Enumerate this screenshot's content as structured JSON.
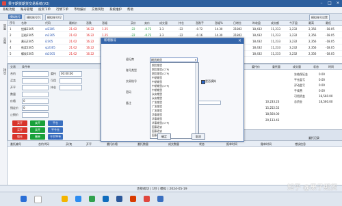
{
  "app": {
    "title": "果子期货期货交易系统(V2)"
  },
  "menu": [
    "系统功能",
    "账号管理",
    "投资下单",
    "行情下单",
    "市场报价",
    "交易风险",
    "系统维护",
    "帮助"
  ],
  "accounts": {
    "tabs": [
      "模拟账号",
      "模拟账号01",
      "模拟账号02"
    ],
    "right_tab": "模拟账号设置"
  },
  "left_strip": [
    "资金",
    "交易",
    "持仓"
  ],
  "positions": {
    "headers": [
      "序号",
      "名称",
      "代码",
      "最新价",
      "涨跌",
      "涨幅",
      "买价",
      "卖价",
      "成交量",
      "持仓",
      "涨跌手",
      "涨幅%",
      "日增仓",
      "昨收盘",
      "成交额",
      "今开盘",
      "最高",
      "最低"
    ],
    "rows": [
      [
        "1",
        "铝棒2305",
        "al2305",
        "21.02",
        "16.22",
        "1.25",
        "-22",
        "-0.72",
        "3.3",
        "-22",
        "-0.72",
        "14.30",
        "21802",
        "18,432",
        "11,233",
        "3,232",
        "2,356",
        "-18.05"
      ],
      [
        "2",
        "豆粕2305",
        "m2305",
        "21.02",
        "16.22",
        "1.25",
        "-22",
        "-0.72",
        "3.3",
        "-22",
        "-0.16",
        "14.30",
        "21802",
        "18,432",
        "11,233",
        "3,232",
        "2,356",
        "-18.05"
      ],
      [
        "3",
        "黄石2305",
        "i2305",
        "21.02",
        "16.22",
        "1.25",
        "-22",
        "-0.72",
        "3.3",
        "-22",
        "-0.72",
        "14.30",
        "21802",
        "18,432",
        "11,233",
        "3,232",
        "2,356",
        "-18.05"
      ],
      [
        "4",
        "纸浆2305",
        "sp2305",
        "21.02",
        "16.22",
        "1.25",
        "-22",
        "-0.72",
        "3.3",
        "-22",
        "-0.16",
        "14.30",
        "21802",
        "18,432",
        "11,233",
        "3,232",
        "2,356",
        "-18.05"
      ],
      [
        "5",
        "螺纹2305",
        "rb2305",
        "21.02",
        "16.22",
        "1.25",
        "-22",
        "-0.72",
        "3.3",
        "-22",
        "-0.72",
        "14.30",
        "21802",
        "18,432",
        "11,233",
        "3,232",
        "2,356",
        "-18.05"
      ]
    ]
  },
  "order": {
    "tabs": [
      "交易",
      "条件单"
    ],
    "fields": [
      {
        "label": "合约",
        "value": ""
      },
      {
        "label": "买卖",
        "value": ""
      },
      {
        "label": "开平",
        "value": ""
      },
      {
        "label": "数量",
        "value": ""
      },
      {
        "label": "价格",
        "value": "0"
      },
      {
        "label": "指定价",
        "value": "0"
      },
      {
        "label": "止损价",
        "value": ""
      }
    ],
    "right_fields": [
      {
        "label": "委托",
        "value": "00:00:00"
      },
      {
        "label": "可用",
        "value": ""
      },
      {
        "label": "持仓",
        "value": ""
      }
    ],
    "buttons": [
      "买开",
      "卖开",
      "平仓",
      "买开",
      "卖开",
      "平今仓",
      "锁仓",
      "撤单",
      "全部撤单"
    ]
  },
  "right_list": {
    "headers": [
      "合约",
      "买卖",
      "开平",
      "委托价",
      "委托量",
      "成交量",
      "状态",
      "时间"
    ],
    "summary": [
      {
        "label": "冻结保证金",
        "value": "0.00"
      },
      {
        "label": "平仓盈亏",
        "value": "0.00"
      },
      {
        "label": "浮动盈亏",
        "value": "0.00"
      },
      {
        "label": "手续费",
        "value": "0.00"
      },
      {
        "label": "可用资金",
        "value": "18,560.00"
      },
      {
        "label": "总资金",
        "value": "18,560.00"
      }
    ],
    "amounts": [
      "10,233.23",
      "15,252.52",
      "18,560.00",
      "20,133.43"
    ]
  },
  "bottom_table": {
    "title": "成交明细",
    "right_title": "委托记录",
    "headers": [
      "委托编号",
      "合约代码",
      "买/卖",
      "开平",
      "委托价格",
      "委托数量",
      "成交数量",
      "状态",
      "报单时间",
      "撤单时间",
      "错误信息"
    ]
  },
  "status": {
    "text": "连接成功 | 1秒 | 模拟 | 2024-05-19"
  },
  "dialog": {
    "title": "新增账号",
    "labels": [
      "经纪商",
      "账号类型",
      "交易账号",
      "密码",
      "备注"
    ],
    "selected": "期货期货",
    "dropdown": [
      "期货期货",
      "期货期货(CTP)",
      "期货期货(CTP)",
      "中期期货",
      "中期期货",
      "中期期货(CTP)",
      "中期期货",
      "永安期货",
      "永安期货",
      "广发期货",
      "广发期货",
      "广发期货",
      "华泰期货",
      "华泰期货",
      "华泰期货(CTP)",
      "国泰君安",
      "国泰君安",
      "国泰君安(CTP)"
    ],
    "checkbox": "是否模拟",
    "ok": "确定",
    "cancel": "取消"
  },
  "watermark": "知乎 @果子期货"
}
